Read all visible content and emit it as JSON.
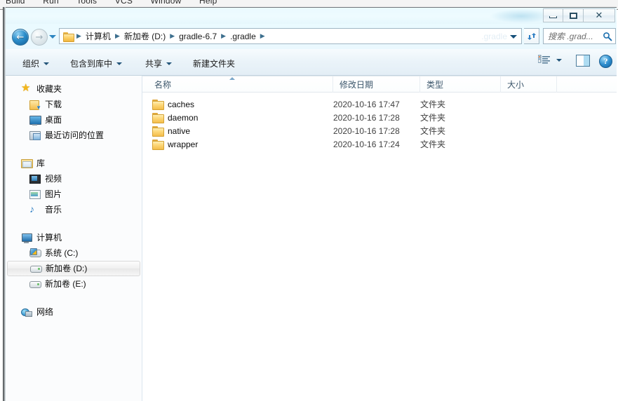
{
  "background_app": {
    "menu_items": [
      "Build",
      "Run",
      "Tools",
      "VCS",
      "Window",
      "Help"
    ]
  },
  "window": {
    "controls": {
      "minimize": "−",
      "maximize": "□",
      "close": "✕"
    }
  },
  "address_bar": {
    "back_arrow": "←",
    "forward_arrow": "→",
    "breadcrumbs": [
      "计算机",
      "新加卷 (D:)",
      "gradle-6.7",
      ".gradle"
    ],
    "separator": "▶",
    "ghost_text": ".gradle",
    "refresh_title": "刷新"
  },
  "search": {
    "placeholder": "搜索 .grad..."
  },
  "toolbar": {
    "organize_label": "组织",
    "include_library_label": "包含到库中",
    "share_label": "共享",
    "new_folder_label": "新建文件夹",
    "help_label": "?"
  },
  "sidebar": {
    "groups": [
      {
        "header": "收藏夹",
        "items": [
          {
            "label": "下载",
            "selected": false
          },
          {
            "label": "桌面",
            "selected": false
          },
          {
            "label": "最近访问的位置",
            "selected": false
          }
        ]
      },
      {
        "header": "库",
        "items": [
          {
            "label": "视频",
            "selected": false
          },
          {
            "label": "图片",
            "selected": false
          },
          {
            "label": "音乐",
            "selected": false
          }
        ]
      },
      {
        "header": "计算机",
        "items": [
          {
            "label": "系统 (C:)",
            "selected": false
          },
          {
            "label": "新加卷 (D:)",
            "selected": true
          },
          {
            "label": "新加卷 (E:)",
            "selected": false
          }
        ]
      },
      {
        "header": "网络",
        "items": []
      }
    ]
  },
  "file_list": {
    "columns": [
      "名称",
      "修改日期",
      "类型",
      "大小"
    ],
    "sort_column": "名称",
    "sort_direction": "ascending",
    "rows": [
      {
        "name": "caches",
        "date": "2020-10-16 17:47",
        "type": "文件夹",
        "size": ""
      },
      {
        "name": "daemon",
        "date": "2020-10-16 17:28",
        "type": "文件夹",
        "size": ""
      },
      {
        "name": "native",
        "date": "2020-10-16 17:28",
        "type": "文件夹",
        "size": ""
      },
      {
        "name": "wrapper",
        "date": "2020-10-16 17:24",
        "type": "文件夹",
        "size": ""
      }
    ]
  },
  "colors": {
    "aero_glass": "#eafaff",
    "accent_blue": "#2b8ecb",
    "folder_gold": "#f4bd4a",
    "header_text": "#3c566b"
  }
}
